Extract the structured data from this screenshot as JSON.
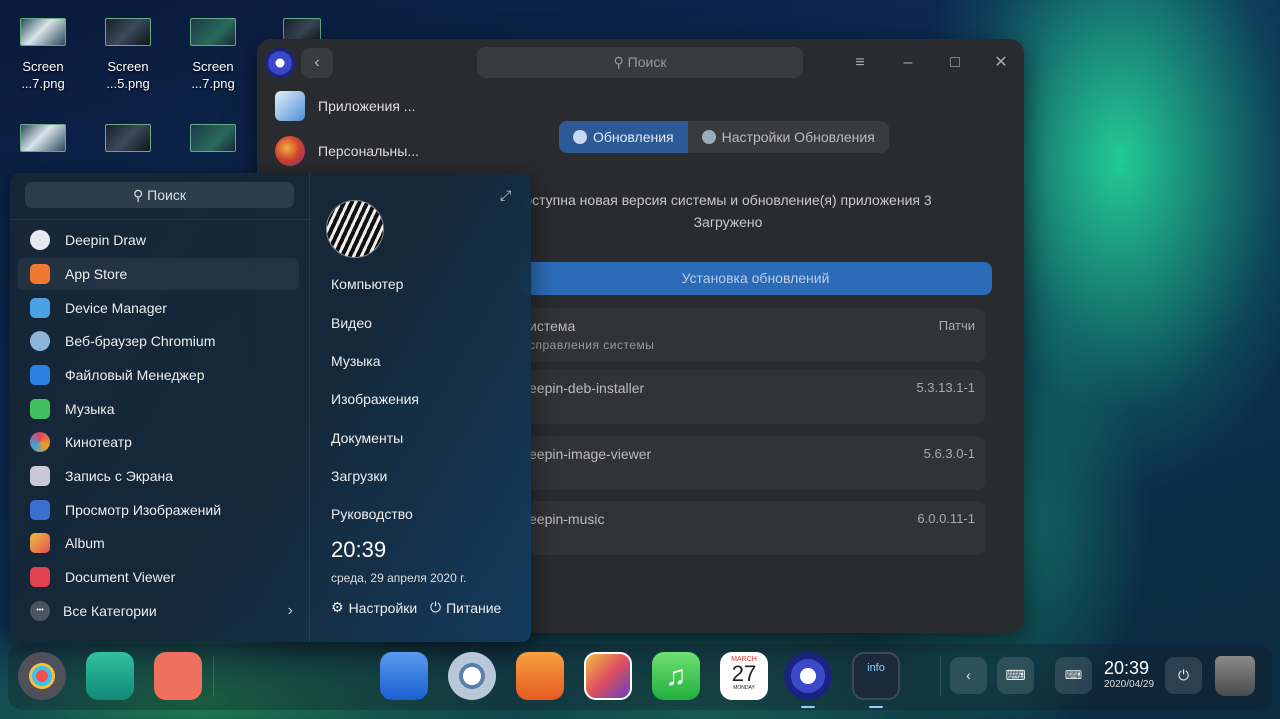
{
  "desktop": {
    "icons": [
      {
        "line1": "Screen",
        "line2": "...7.png"
      },
      {
        "line1": "Screen",
        "line2": "...5.png"
      },
      {
        "line1": "Screen",
        "line2": "...7.png"
      }
    ]
  },
  "window": {
    "search_placeholder": "Поиск",
    "back": "‹",
    "menu": "≡",
    "minimize": "–",
    "maximize": "□",
    "close": "✕",
    "sidebar": [
      {
        "label": "Приложения ..."
      },
      {
        "label": "Персональны..."
      }
    ],
    "tabs": [
      {
        "label": "Обновления"
      },
      {
        "label": "Настройки Обновления"
      }
    ],
    "update_info_line1": "оступна новая версия системы и  обновление(я) приложения 3",
    "update_info_line2": "Загружено",
    "install_button": "Установка обновлений",
    "updates": [
      {
        "name": "истема",
        "sub": "справления  системы",
        "version": "Патчи"
      },
      {
        "name": "eepin-deb-installer",
        "sub": "",
        "version": "5.3.13.1-1"
      },
      {
        "name": "eepin-image-viewer",
        "sub": "",
        "version": "5.6.3.0-1"
      },
      {
        "name": "eepin-music",
        "sub": "",
        "version": "6.0.0.11-1"
      }
    ]
  },
  "launcher": {
    "search": "Поиск",
    "apps": [
      {
        "label": "Deepin Draw",
        "color": "#e8e8f0"
      },
      {
        "label": "App Store",
        "color": "#f07830"
      },
      {
        "label": "Device Manager",
        "color": "#4aa0e0"
      },
      {
        "label": "Веб-браузер Chromium",
        "color": "#8ab4d8"
      },
      {
        "label": "Файловый Менеджер",
        "color": "#2a80e0"
      },
      {
        "label": "Музыка",
        "color": "#40c060"
      },
      {
        "label": "Кинотеатр",
        "color": "#e04060"
      },
      {
        "label": "Запись с Экрана",
        "color": "#c8c8d8"
      },
      {
        "label": "Просмотр Изображений",
        "color": "#3a70d0"
      },
      {
        "label": "Album",
        "color": "#f09040"
      },
      {
        "label": "Document Viewer",
        "color": "#e04050"
      }
    ],
    "all_categories": "Все Категории",
    "more_icon": "•••",
    "arrow": "›",
    "places": [
      "Компьютер",
      "Видео",
      "Музыка",
      "Изображения",
      "Документы",
      "Загрузки",
      "Руководство"
    ],
    "time": "20:39",
    "date": "среда, 29 апреля 2020 г.",
    "settings": "Настройки",
    "power": "Питание",
    "gear": "⚙",
    "power_glyph": "⏻",
    "expand": "⤢"
  },
  "dock": {
    "time": "20:39",
    "date": "2020/04/29",
    "calendar_month": "MARCH",
    "calendar_day": "27",
    "calendar_weekday": "MONDAY",
    "info_label": "info",
    "arrow_left": "‹",
    "keyboard": "⌨",
    "power": "⏻"
  }
}
